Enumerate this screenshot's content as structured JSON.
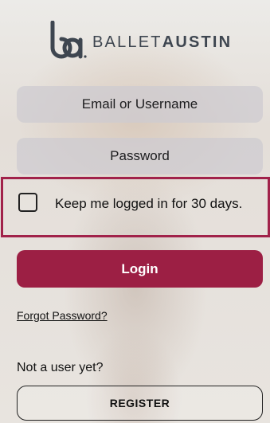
{
  "logo": {
    "icon": "ballet-austin-logo-icon",
    "text_light": "BALLET",
    "text_bold": "AUSTIN"
  },
  "form": {
    "email_placeholder": "Email or Username",
    "password_placeholder": "Password",
    "keep_logged_in_label": "Keep me logged in for 30 days.",
    "keep_logged_in_checked": false,
    "login_label": "Login",
    "forgot_password_label": "Forgot Password?"
  },
  "register": {
    "prompt": "Not a user yet?",
    "button_label": "REGISTER"
  },
  "colors": {
    "accent": "#9c1f44",
    "highlight_border": "#a1224a",
    "logo": "#3e4650"
  }
}
